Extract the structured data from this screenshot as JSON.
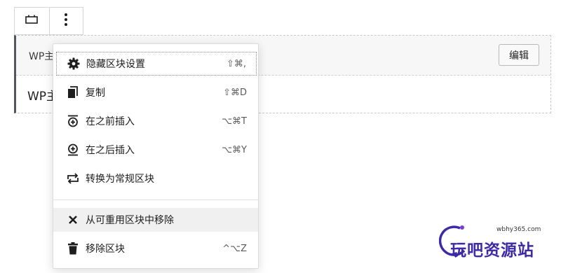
{
  "toolbar": {
    "block_icon": "reusable-block-icon",
    "options_icon": "more-vertical-icon"
  },
  "reusable_block": {
    "title": "WP主",
    "edit_label": "编辑",
    "content": "WP主"
  },
  "menu": {
    "items": [
      {
        "icon": "gear-icon",
        "label": "隐藏区块设置",
        "shortcut": "⇧⌘,"
      },
      {
        "icon": "copy-icon",
        "label": "复制",
        "shortcut": "⇧⌘D"
      },
      {
        "icon": "insert-before-icon",
        "label": "在之前插入",
        "shortcut": "⌥⌘T"
      },
      {
        "icon": "insert-after-icon",
        "label": "在之后插入",
        "shortcut": "⌥⌘Y"
      },
      {
        "icon": "convert-icon",
        "label": "转换为常规区块",
        "shortcut": ""
      },
      {
        "icon": "close-icon",
        "label": "从可重用区块中移除",
        "shortcut": ""
      },
      {
        "icon": "trash-icon",
        "label": "移除区块",
        "shortcut": "^⌥Z"
      }
    ]
  },
  "watermark": {
    "url": "wbhy365.com",
    "text": "玩吧资源站",
    "color": "#3d2aa6"
  }
}
